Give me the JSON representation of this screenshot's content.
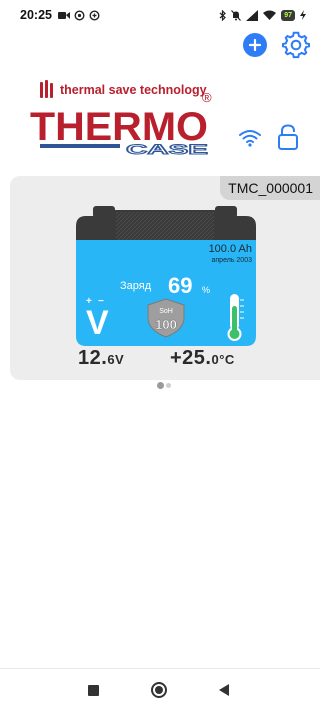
{
  "status_bar": {
    "time": "20:25",
    "battery_level": "97"
  },
  "logo": {
    "tagline": "thermal save technology",
    "brand_top": "THERMO",
    "brand_bottom": "CASE",
    "registered": "®"
  },
  "device": {
    "id": "TMC_000001",
    "capacity": "100.0 Ah",
    "date": "апрель 2003",
    "charge_label": "Заряд",
    "charge_value": "69",
    "charge_unit": "%",
    "soh_label": "SoH",
    "soh_value": "100",
    "voltage_symbol": "V",
    "voltage_main": "12.",
    "voltage_decimal": "6",
    "voltage_unit": "V",
    "temp_main": "+25.",
    "temp_decimal": "0",
    "temp_unit": "°C"
  },
  "colors": {
    "accent": "#2f7df6",
    "battery_face": "#29b6f6",
    "battery_top": "#3a3a3a",
    "thermometer": "#3cc06a",
    "brand_red": "#b8202e",
    "brand_blue": "#2f5597"
  },
  "icons": {
    "add": "plus-icon",
    "settings": "gear-icon",
    "wifi": "wifi-icon",
    "lock": "lock-icon"
  }
}
